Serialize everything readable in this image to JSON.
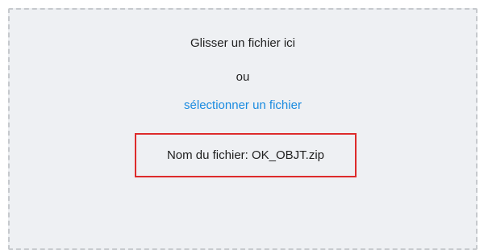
{
  "dropzone": {
    "drop_text": "Glisser un fichier ici",
    "or_text": "ou",
    "select_link": "sélectionner un fichier",
    "file_label": "Nom du fichier:",
    "file_name": "OK_OBJT.zip"
  },
  "colors": {
    "link": "#1a8be0",
    "highlight_border": "#dd2b2b",
    "dropzone_bg": "#eef0f3",
    "dropzone_border": "#c6c9cd"
  }
}
